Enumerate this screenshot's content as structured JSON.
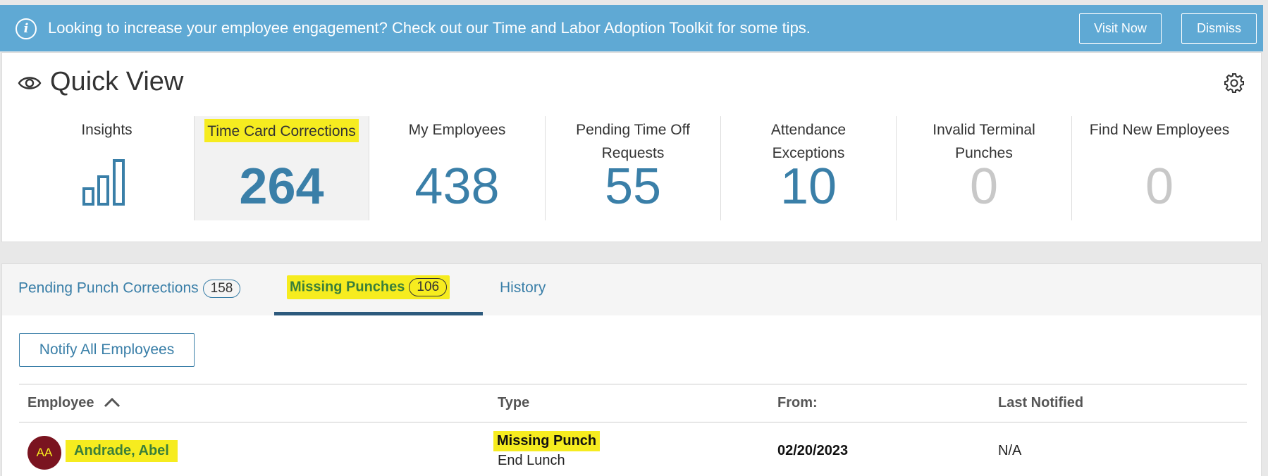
{
  "banner": {
    "icon": "info-icon",
    "message": "Looking to increase your employee engagement? Check out our Time and Labor Adoption Toolkit for some tips.",
    "visit_label": "Visit Now",
    "dismiss_label": "Dismiss",
    "color": "#5fa9d4"
  },
  "quick_view": {
    "title": "Quick View",
    "title_icon": "eye-icon",
    "settings_icon": "gear-icon",
    "tiles": [
      {
        "label": "Insights",
        "icon": "bar-chart-icon"
      },
      {
        "label": "Time Card Corrections",
        "value": "264"
      },
      {
        "label": "My Employees",
        "value": "438"
      },
      {
        "label": "Pending Time Off Requests",
        "value": "55"
      },
      {
        "label": "Attendance Exceptions",
        "value": "10"
      },
      {
        "label": "Invalid Terminal Punches",
        "value": "0"
      },
      {
        "label": "Find New Employees",
        "value": "0"
      }
    ],
    "accent": "#3a7fa8"
  },
  "punch": {
    "tabs": [
      {
        "label": "Pending Punch Corrections",
        "count": "158"
      },
      {
        "label": "Missing Punches",
        "count": "106"
      },
      {
        "label": "History"
      }
    ],
    "notify_label": "Notify All Employees",
    "columns": [
      "Employee",
      "Type",
      "From:",
      "Last Notified"
    ],
    "sort_icon": "chevron-up-icon",
    "rows": [
      {
        "initials": "AA",
        "name": "Andrade, Abel",
        "type": "Missing Punch",
        "subtype": "End Lunch",
        "from": "02/20/2023",
        "last_notified": "N/A"
      }
    ]
  },
  "highlight_color": "#f6ec1f"
}
